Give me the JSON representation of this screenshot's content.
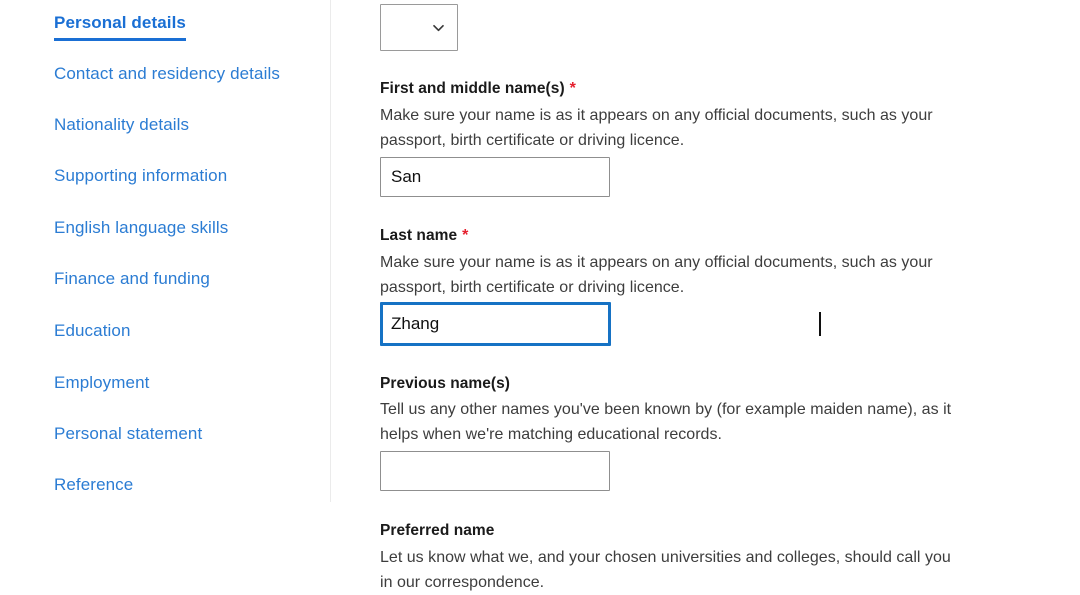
{
  "sidebar": {
    "items": [
      {
        "label": "Personal details",
        "active": true
      },
      {
        "label": "Contact and residency details",
        "active": false
      },
      {
        "label": "Nationality details",
        "active": false
      },
      {
        "label": "Supporting information",
        "active": false
      },
      {
        "label": "English language skills",
        "active": false
      },
      {
        "label": "Finance and funding",
        "active": false
      },
      {
        "label": "Education",
        "active": false
      },
      {
        "label": "Employment",
        "active": false
      },
      {
        "label": "Personal statement",
        "active": false
      },
      {
        "label": "Reference",
        "active": false
      }
    ]
  },
  "form": {
    "title_select": {
      "value": "",
      "icon": "chevron-down-icon"
    },
    "fields": [
      {
        "label": "First and middle name(s)",
        "required": true,
        "required_marker": "*",
        "hint": "Make sure your name is as it appears on any official documents, such as your passport, birth certificate or driving licence.",
        "value": "San",
        "placeholder": "",
        "focused": false
      },
      {
        "label": "Last name",
        "required": true,
        "required_marker": "*",
        "hint": "Make sure your name is as it appears on any official documents, such as your passport, birth certificate or driving licence.",
        "value": "Zhang",
        "placeholder": "",
        "focused": true
      },
      {
        "label": "Previous name(s)",
        "required": false,
        "required_marker": "",
        "hint": "Tell us any other names you've been known by (for example maiden name), as it helps when we're matching educational records.",
        "value": "",
        "placeholder": "",
        "focused": false
      },
      {
        "label": "Preferred name",
        "required": false,
        "required_marker": "",
        "hint": "Let us know what we, and your chosen universities and colleges, should call you in our correspondence.",
        "value": "",
        "placeholder": "",
        "focused": false
      }
    ]
  },
  "colors": {
    "link_blue": "#2b7cd3",
    "active_blue": "#1a6fd4",
    "focus_blue": "#1672c4",
    "required_red": "#e5202e",
    "text_dark": "#1a1a1a",
    "hint_grey": "#3d3d3d",
    "border_grey": "#8f8f8f",
    "divider_grey": "#ebebeb"
  }
}
